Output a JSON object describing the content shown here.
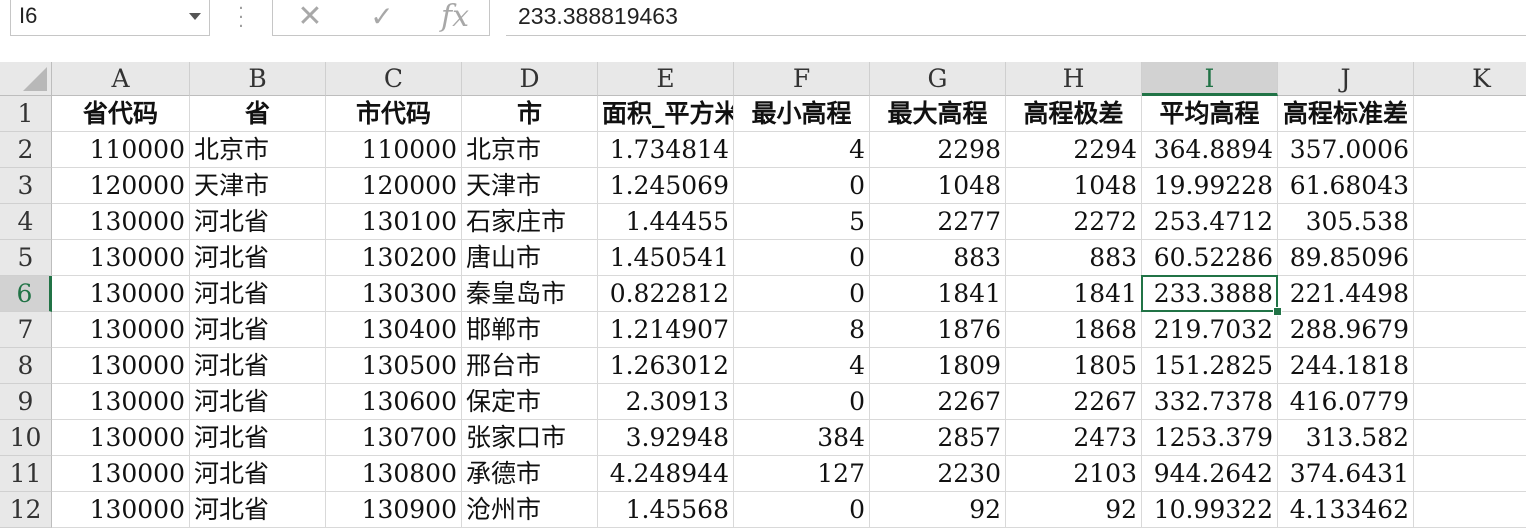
{
  "formula_bar": {
    "name_box": "I6",
    "cancel_icon": "close-icon",
    "enter_icon": "check-icon",
    "insert_function_label": "fx",
    "formula_value": "233.388819463"
  },
  "accent_color": "#217346",
  "columns": [
    "A",
    "B",
    "C",
    "D",
    "E",
    "F",
    "G",
    "H",
    "I",
    "J",
    "K"
  ],
  "rows": [
    "1",
    "2",
    "3",
    "4",
    "5",
    "6",
    "7",
    "8",
    "9",
    "10",
    "11",
    "12"
  ],
  "selected_cell": {
    "column": "I",
    "row": "6"
  },
  "table": {
    "header": [
      "省代码",
      "省",
      "市代码",
      "市",
      "面积_平方米",
      "最小高程",
      "最大高程",
      "高程极差",
      "平均高程",
      "高程标准差"
    ],
    "data": [
      [
        "110000",
        "北京市",
        "110000",
        "北京市",
        "1.734814",
        "4",
        "2298",
        "2294",
        "364.8894",
        "357.0006"
      ],
      [
        "120000",
        "天津市",
        "120000",
        "天津市",
        "1.245069",
        "0",
        "1048",
        "1048",
        "19.99228",
        "61.68043"
      ],
      [
        "130000",
        "河北省",
        "130100",
        "石家庄市",
        "1.44455",
        "5",
        "2277",
        "2272",
        "253.4712",
        "305.538"
      ],
      [
        "130000",
        "河北省",
        "130200",
        "唐山市",
        "1.450541",
        "0",
        "883",
        "883",
        "60.52286",
        "89.85096"
      ],
      [
        "130000",
        "河北省",
        "130300",
        "秦皇岛市",
        "0.822812",
        "0",
        "1841",
        "1841",
        "233.3888",
        "221.4498"
      ],
      [
        "130000",
        "河北省",
        "130400",
        "邯郸市",
        "1.214907",
        "8",
        "1876",
        "1868",
        "219.7032",
        "288.9679"
      ],
      [
        "130000",
        "河北省",
        "130500",
        "邢台市",
        "1.263012",
        "4",
        "1809",
        "1805",
        "151.2825",
        "244.1818"
      ],
      [
        "130000",
        "河北省",
        "130600",
        "保定市",
        "2.30913",
        "0",
        "2267",
        "2267",
        "332.7378",
        "416.0779"
      ],
      [
        "130000",
        "河北省",
        "130700",
        "张家口市",
        "3.92948",
        "384",
        "2857",
        "2473",
        "1253.379",
        "313.582"
      ],
      [
        "130000",
        "河北省",
        "130800",
        "承德市",
        "4.248944",
        "127",
        "2230",
        "2103",
        "944.2642",
        "374.6431"
      ],
      [
        "130000",
        "河北省",
        "130900",
        "沧州市",
        "1.45568",
        "0",
        "92",
        "92",
        "10.99322",
        "4.133462"
      ]
    ]
  }
}
